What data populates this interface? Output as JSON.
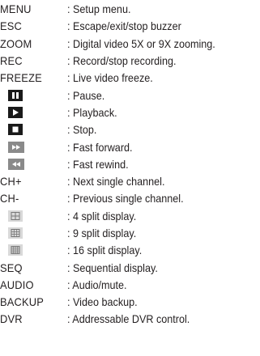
{
  "rows": [
    {
      "key": "MENU",
      "desc": ": Setup menu."
    },
    {
      "key": "ESC",
      "desc": ": Escape/exit/stop buzzer"
    },
    {
      "key": "ZOOM",
      "desc": ": Digital video 5X or 9X zooming."
    },
    {
      "key": "REC",
      "desc": ": Record/stop recording."
    },
    {
      "key": "FREEZE",
      "desc": ": Live video freeze."
    },
    {
      "icon": "pause-icon",
      "desc": ": Pause."
    },
    {
      "icon": "play-icon",
      "desc": ": Playback."
    },
    {
      "icon": "stop-icon",
      "desc": ": Stop."
    },
    {
      "icon": "fast-forward-icon",
      "desc": ": Fast forward."
    },
    {
      "icon": "fast-rewind-icon",
      "desc": ": Fast rewind."
    },
    {
      "key": "CH+",
      "desc": ": Next single channel."
    },
    {
      "key": "CH-",
      "desc": ": Previous single channel."
    },
    {
      "icon": "split-4-icon",
      "desc": ": 4 split display."
    },
    {
      "icon": "split-9-icon",
      "desc": ": 9 split display."
    },
    {
      "icon": "split-16-icon",
      "desc": ": 16 split display."
    },
    {
      "key": "SEQ",
      "desc": ": Sequential display."
    },
    {
      "key": "AUDIO",
      "desc": ": Audio/mute."
    },
    {
      "key": "BACKUP",
      "desc": ": Video backup."
    },
    {
      "key": "DVR",
      "desc": ": Addressable DVR control."
    }
  ],
  "colors": {
    "text": "#231f20",
    "icon_dark": "#1a1a1a",
    "icon_gray": "#8a8a8a",
    "split_fill": "#d9d9d9",
    "split_line": "#777777"
  }
}
